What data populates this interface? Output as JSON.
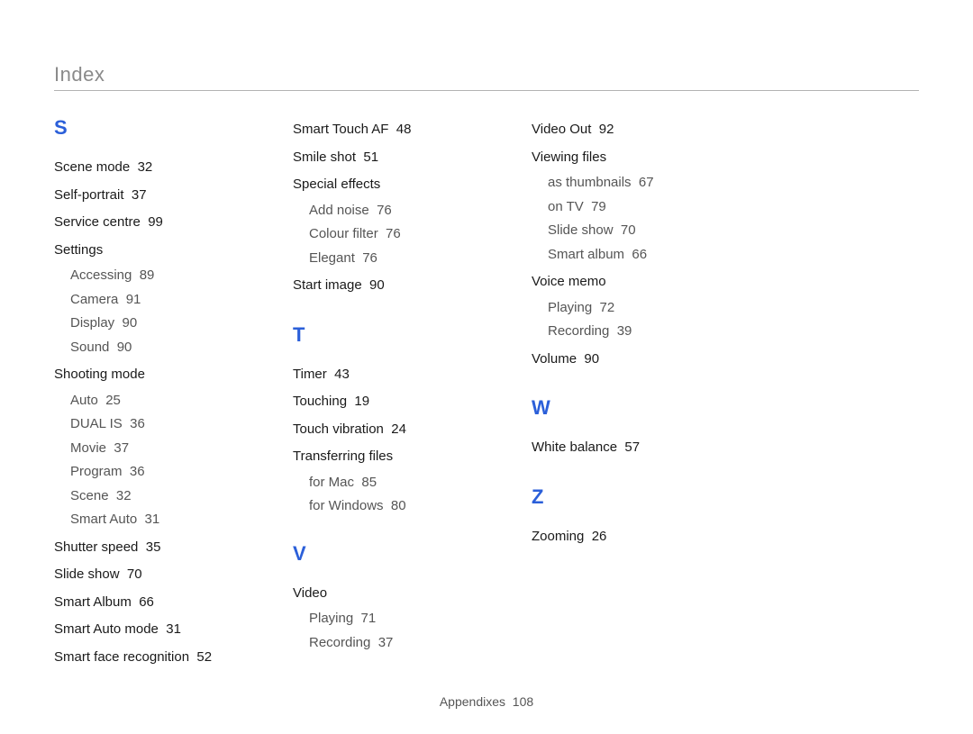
{
  "header": {
    "title": "Index"
  },
  "footer": {
    "section": "Appendixes",
    "page": "108"
  },
  "col1": {
    "letterS": "S",
    "sceneMode": {
      "label": "Scene mode",
      "page": "32"
    },
    "selfPortrait": {
      "label": "Self-portrait",
      "page": "37"
    },
    "serviceCentre": {
      "label": "Service centre",
      "page": "99"
    },
    "settings": {
      "label": "Settings"
    },
    "settingsAccessing": {
      "label": "Accessing",
      "page": "89"
    },
    "settingsCamera": {
      "label": "Camera",
      "page": "91"
    },
    "settingsDisplay": {
      "label": "Display",
      "page": "90"
    },
    "settingsSound": {
      "label": "Sound",
      "page": "90"
    },
    "shootingMode": {
      "label": "Shooting mode"
    },
    "shootingAuto": {
      "label": "Auto",
      "page": "25"
    },
    "shootingDualIS": {
      "label": "DUAL IS",
      "page": "36"
    },
    "shootingMovie": {
      "label": "Movie",
      "page": "37"
    },
    "shootingProgram": {
      "label": "Program",
      "page": "36"
    },
    "shootingScene": {
      "label": "Scene",
      "page": "32"
    },
    "shootingSmartAuto": {
      "label": "Smart Auto",
      "page": "31"
    },
    "shutterSpeed": {
      "label": "Shutter speed",
      "page": "35"
    },
    "slideShow": {
      "label": "Slide show",
      "page": "70"
    },
    "smartAlbum": {
      "label": "Smart Album",
      "page": "66"
    },
    "smartAutoMode": {
      "label": "Smart Auto mode",
      "page": "31"
    },
    "smartFaceRec": {
      "label": "Smart face recognition",
      "page": "52"
    }
  },
  "col2": {
    "smartTouchAF": {
      "label": "Smart Touch AF",
      "page": "48"
    },
    "smileShot": {
      "label": "Smile shot",
      "page": "51"
    },
    "specialEffects": {
      "label": "Special effects"
    },
    "seAddNoise": {
      "label": "Add noise",
      "page": "76"
    },
    "seColourFilter": {
      "label": "Colour filter",
      "page": "76"
    },
    "seElegant": {
      "label": "Elegant",
      "page": "76"
    },
    "startImage": {
      "label": "Start image",
      "page": "90"
    },
    "letterT": "T",
    "timer": {
      "label": "Timer",
      "page": "43"
    },
    "touching": {
      "label": "Touching",
      "page": "19"
    },
    "touchVibration": {
      "label": "Touch vibration",
      "page": "24"
    },
    "transferringFiles": {
      "label": "Transferring files"
    },
    "tfMac": {
      "label": "for Mac",
      "page": "85"
    },
    "tfWindows": {
      "label": "for Windows",
      "page": "80"
    },
    "letterV": "V",
    "video": {
      "label": "Video"
    },
    "videoPlaying": {
      "label": "Playing",
      "page": "71"
    },
    "videoRecording": {
      "label": "Recording",
      "page": "37"
    }
  },
  "col3": {
    "videoOut": {
      "label": "Video Out",
      "page": "92"
    },
    "viewingFiles": {
      "label": "Viewing files"
    },
    "vfThumbnails": {
      "label": "as thumbnails",
      "page": "67"
    },
    "vfOnTV": {
      "label": "on TV",
      "page": "79"
    },
    "vfSlideShow": {
      "label": "Slide show",
      "page": "70"
    },
    "vfSmartAlbum": {
      "label": "Smart album",
      "page": "66"
    },
    "voiceMemo": {
      "label": "Voice memo"
    },
    "vmPlaying": {
      "label": "Playing",
      "page": "72"
    },
    "vmRecording": {
      "label": "Recording",
      "page": "39"
    },
    "volume": {
      "label": "Volume",
      "page": "90"
    },
    "letterW": "W",
    "whiteBalance": {
      "label": "White balance",
      "page": "57"
    },
    "letterZ": "Z",
    "zooming": {
      "label": "Zooming",
      "page": "26"
    }
  }
}
